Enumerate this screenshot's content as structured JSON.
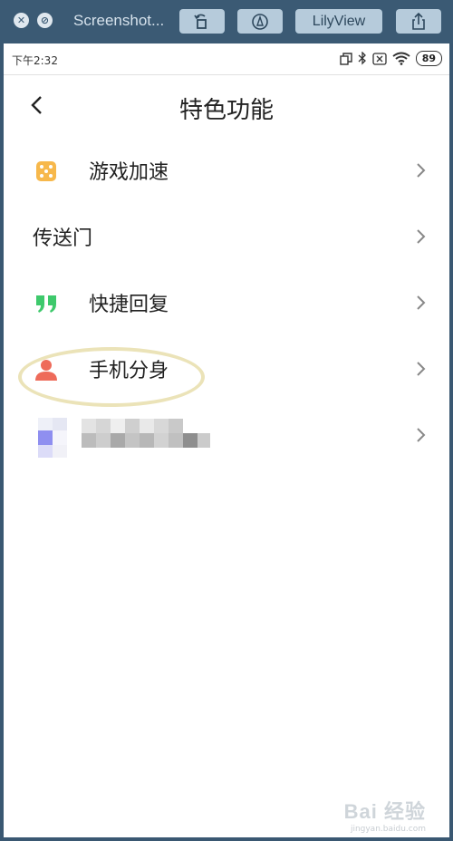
{
  "viewer": {
    "title": "Screenshot...",
    "lilyview_label": "LilyView",
    "close_icon": "close-x-icon",
    "minimize_icon": "no-entry-icon",
    "rotate_icon": "rotate-icon",
    "markup_icon": "pen-markup-icon",
    "share_icon": "share-icon"
  },
  "status_bar": {
    "time": "下午2:32",
    "battery": "89"
  },
  "header": {
    "title": "特色功能"
  },
  "menu": {
    "items": [
      {
        "label": "游戏加速",
        "icon": "dice-icon",
        "color": "#f7b84b"
      },
      {
        "label": "传送门",
        "icon": "",
        "color": ""
      },
      {
        "label": "快捷回复",
        "icon": "quote-icon",
        "color": "#3ec96c"
      },
      {
        "label": "手机分身",
        "icon": "person-icon",
        "color": "#ee6b5a"
      }
    ]
  },
  "watermark": {
    "main": "Bai 经验",
    "sub": "jingyan.baidu.com"
  },
  "colors": {
    "viewer_bar": "#3b5a74",
    "highlight_ring": "#ebe3b8"
  }
}
